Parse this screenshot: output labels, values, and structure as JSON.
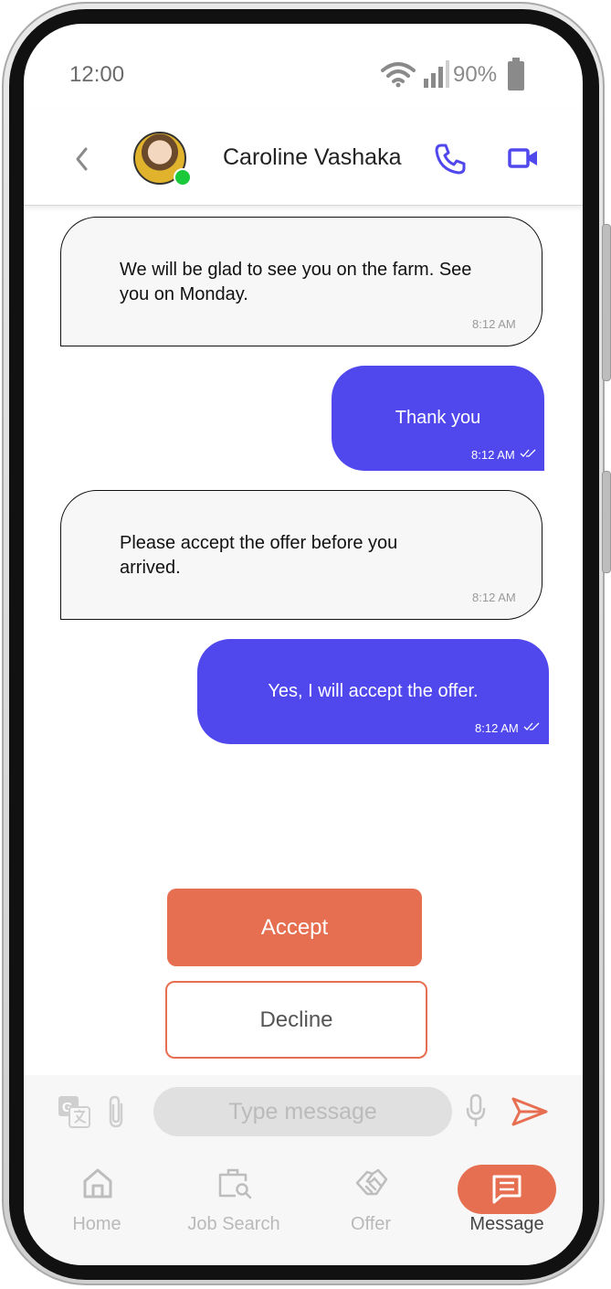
{
  "status_bar": {
    "time": "12:00",
    "battery": "90%"
  },
  "header": {
    "contact_name": "Caroline Vashaka",
    "online": true
  },
  "messages": [
    {
      "direction": "incoming",
      "text": "We will be glad to see you on the farm. See you on Monday.",
      "time": "8:12 AM"
    },
    {
      "direction": "outgoing",
      "text": "Thank you",
      "time": "8:12 AM",
      "read": true
    },
    {
      "direction": "incoming",
      "text": "Please accept the offer before you arrived.",
      "time": "8:12 AM"
    },
    {
      "direction": "outgoing",
      "text": "Yes, I will accept the offer.",
      "time": "8:12 AM",
      "read": true
    }
  ],
  "actions": {
    "accept_label": "Accept",
    "decline_label": "Decline"
  },
  "composer": {
    "placeholder": "Type message",
    "value": ""
  },
  "nav": {
    "items": [
      {
        "label": "Home",
        "icon": "home-icon",
        "active": false
      },
      {
        "label": "Job Search",
        "icon": "job-search-icon",
        "active": false
      },
      {
        "label": "Offer",
        "icon": "handshake-icon",
        "active": false
      },
      {
        "label": "Message",
        "icon": "message-icon",
        "active": true
      }
    ]
  },
  "colors": {
    "accent": "#5048ec",
    "orange": "#e76f51",
    "online": "#19c93a"
  }
}
